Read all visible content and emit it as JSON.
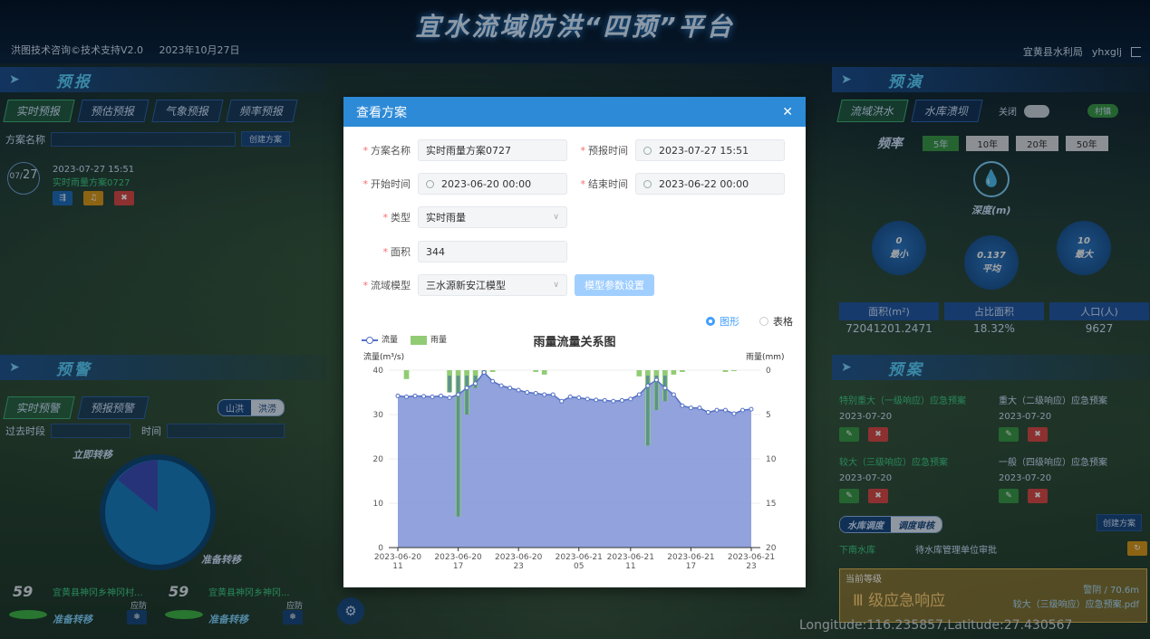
{
  "header": {
    "title": "宜水流域防洪“四预”平台",
    "left_info": "洪图技术咨询©技术支持V2.0",
    "date": "2023年10月27日",
    "org": "宜黄县水利局",
    "user": "yhxglj"
  },
  "left": {
    "forecast_title": "预报",
    "forecast_tabs": [
      "实时预报",
      "预估预报",
      "气象预报",
      "频率预报"
    ],
    "plan_name_label": "方案名称",
    "create_plan_btn": "创建方案",
    "plan_time": "2023-07-27 15:51",
    "plan_name": "实时雨量方案0727",
    "date_badge_month": "07",
    "date_badge_day": "27",
    "warning_title": "预警",
    "warning_tabs": [
      "实时预警",
      "预报预警"
    ],
    "toggle_a": "山洪",
    "toggle_b": "洪涝",
    "past_period_label": "过去时段",
    "time_label": "时间",
    "pie_label_top": "立即转移",
    "pie_label_bottom": "准备转移",
    "bottom_items": [
      {
        "count": "59",
        "name": "宜黄县神冈乡神冈村...",
        "tag": "应防",
        "status": "准备转移"
      },
      {
        "count": "59",
        "name": "宜黄县神冈乡神冈...",
        "tag": "应防",
        "status": "准备转移"
      }
    ]
  },
  "right": {
    "drill_title": "预演",
    "drill_tabs": [
      "流域洪水",
      "水库溃坝"
    ],
    "toggle_label": "关闭",
    "village_btn": "村镇",
    "freq_label": "频率",
    "freq_options": [
      "5年",
      "10年",
      "20年",
      "50年"
    ],
    "depth_label": "深度(m)",
    "min_value": "0",
    "min_label": "最小",
    "avg_value": "0.137",
    "avg_label": "平均",
    "max_value": "10",
    "max_label": "最大",
    "stats": [
      {
        "h": "面积(m²)",
        "v": "72041201.2471"
      },
      {
        "h": "占比面积",
        "v": "18.32%"
      },
      {
        "h": "人口(人)",
        "v": "9627"
      }
    ],
    "plan_title": "预案",
    "plans": [
      {
        "name": "特别重大（一级响应）应急预案",
        "date": "2023-07-20"
      },
      {
        "name": "重大（二级响应）应急预案",
        "date": "2023-07-20"
      },
      {
        "name": "较大（三级响应）应急预案",
        "date": "2023-07-20"
      },
      {
        "name": "一般（四级响应）应急预案",
        "date": "2023-07-20"
      }
    ],
    "dispatch_a": "水库调度",
    "dispatch_b": "调度审核",
    "create_plan_btn": "创建方案",
    "reservoir": "下南水库",
    "review_status": "待水库管理单位审批",
    "level_label": "当前等级",
    "level_value": "Ⅲ 级应急响应",
    "level_desc1": "警阴 / 70.6m",
    "level_file": "较大（三级响应）应急预案.pdf"
  },
  "coords": "Longitude:116.235857,Latitude:27.430567",
  "modal": {
    "title": "查看方案",
    "fields": {
      "plan_name_label": "方案名称",
      "plan_name": "实时雨量方案0727",
      "forecast_time_label": "预报时间",
      "forecast_time": "2023-07-27 15:51",
      "start_time_label": "开始时间",
      "start_time": "2023-06-20 00:00",
      "end_time_label": "结束时间",
      "end_time": "2023-06-22 00:00",
      "type_label": "类型",
      "type": "实时雨量",
      "area_label": "面积",
      "area": "344",
      "model_label": "流域模型",
      "model": "三水源新安江模型",
      "param_btn": "模型参数设置"
    },
    "view_graph": "图形",
    "view_table": "表格"
  },
  "chart_data": {
    "type": "line",
    "title": "雨量流量关系图",
    "ylabel": "流量(m³/s)",
    "y2label": "雨量(mm)",
    "ylim": [
      0,
      40
    ],
    "y2lim": [
      20,
      0
    ],
    "legend": [
      "流量",
      "雨量"
    ],
    "x_tick_labels": [
      "2023-06-20\n11",
      "2023-06-20\n17",
      "2023-06-20\n23",
      "2023-06-21\n05",
      "2023-06-21\n11",
      "2023-06-21\n17",
      "2023-06-21\n23"
    ],
    "y_ticks": [
      0,
      10,
      20,
      30,
      40
    ],
    "y2_ticks": [
      0,
      5,
      10,
      15,
      20
    ],
    "series": [
      {
        "name": "流量",
        "values": [
          34.2,
          34.0,
          34.2,
          34.1,
          34.0,
          34.2,
          33.8,
          34.5,
          36.0,
          37.0,
          39.5,
          37.5,
          36.5,
          36.0,
          35.5,
          35.0,
          34.8,
          34.5,
          34.5,
          33.0,
          34.0,
          33.8,
          33.5,
          33.3,
          33.2,
          33.0,
          33.2,
          33.5,
          34.5,
          36.5,
          37.8,
          36.0,
          34.5,
          32.0,
          31.5,
          31.5,
          30.5,
          31.0,
          31.0,
          30.2,
          31.0,
          31.2
        ]
      },
      {
        "name": "雨量",
        "values": [
          0,
          1.0,
          0,
          0,
          0,
          0,
          2.5,
          16.5,
          5.0,
          2.0,
          0.5,
          0.2,
          0,
          0,
          0,
          0,
          0.2,
          0.5,
          0,
          0,
          0,
          0,
          0,
          0,
          0,
          0,
          0,
          0,
          0.7,
          8.5,
          4.5,
          3.5,
          0.5,
          0.2,
          0,
          0,
          0,
          0,
          0.2,
          0.1,
          0,
          0
        ]
      }
    ]
  }
}
